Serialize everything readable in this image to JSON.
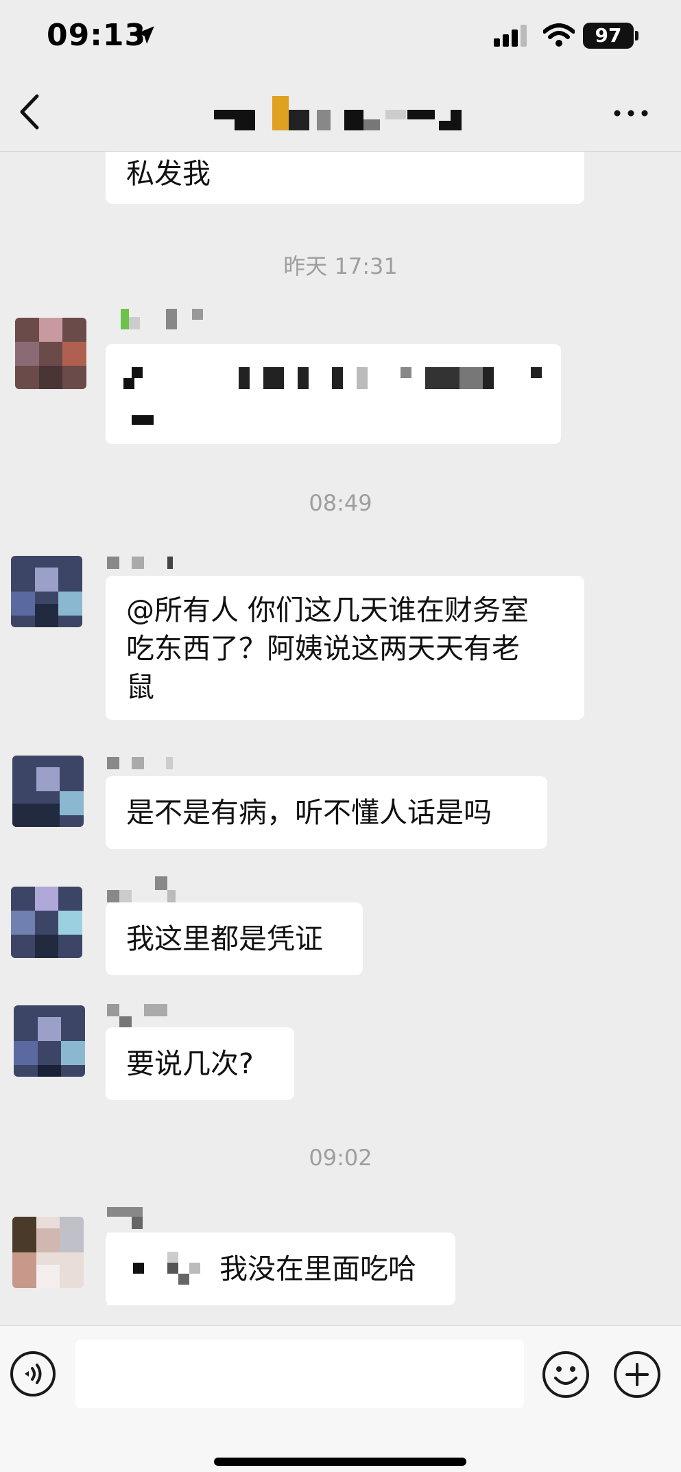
{
  "status_bar": {
    "time": "09:13",
    "battery": "97"
  },
  "nav": {
    "back_icon": "chevron-left-icon",
    "more_icon": "ellipsis-icon"
  },
  "chat": {
    "timestamps": [
      "昨天 17:31",
      "08:49",
      "09:02"
    ],
    "messages": [
      {
        "text": "私发我"
      },
      {
        "text": "@所有人 你们这几天谁在财务室吃东西了？阿姨说这两天天有老鼠",
        "lines": [
          "@所有人 你们这几天谁在财务室",
          "吃东西了？阿姨说这两天天有老",
          "鼠"
        ]
      },
      {
        "text": "是不是有病，听不懂人话是吗"
      },
      {
        "text": "我这里都是凭证"
      },
      {
        "text": "要说几次?"
      },
      {
        "text": "我没在里面吃哈"
      }
    ]
  },
  "input": {
    "placeholder": "",
    "value": ""
  },
  "icons": {
    "voice": "voice-icon",
    "emoji": "emoji-icon",
    "plus": "plus-icon"
  },
  "colors": {
    "background": "#ededed",
    "bubble": "#ffffff",
    "timestamp": "#9e9e9e",
    "input_bar": "#f7f7f7"
  }
}
